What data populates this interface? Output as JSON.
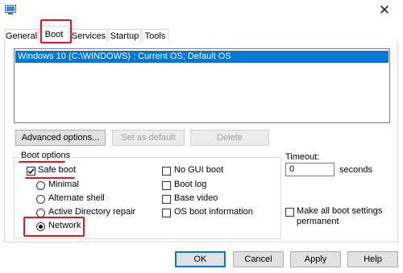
{
  "tabs": [
    "General",
    "Boot",
    "Services",
    "Startup",
    "Tools"
  ],
  "os_entry": "Windows 10 (C:\\WINDOWS) : Current OS; Default OS",
  "buttons": {
    "advanced": "Advanced options...",
    "set_default": "Set as default",
    "delete": "Delete",
    "ok": "OK",
    "cancel": "Cancel",
    "apply": "Apply",
    "help": "Help"
  },
  "boot_options": {
    "legend": "Boot options",
    "safe_boot": "Safe boot",
    "safe_boot_checked": true,
    "radios": [
      "Minimal",
      "Alternate shell",
      "Active Directory repair",
      "Network"
    ],
    "selected_radio": "Network",
    "right_checks": [
      "No GUI boot",
      "Boot log",
      "Base video",
      "OS boot information"
    ]
  },
  "timeout": {
    "label": "Timeout:",
    "value": "0",
    "unit": "seconds"
  },
  "permanent": {
    "line1": "Make all boot settings",
    "line2": "permanent"
  },
  "colors": {
    "accent": "#0078d7",
    "annotation": "#e8141c"
  }
}
